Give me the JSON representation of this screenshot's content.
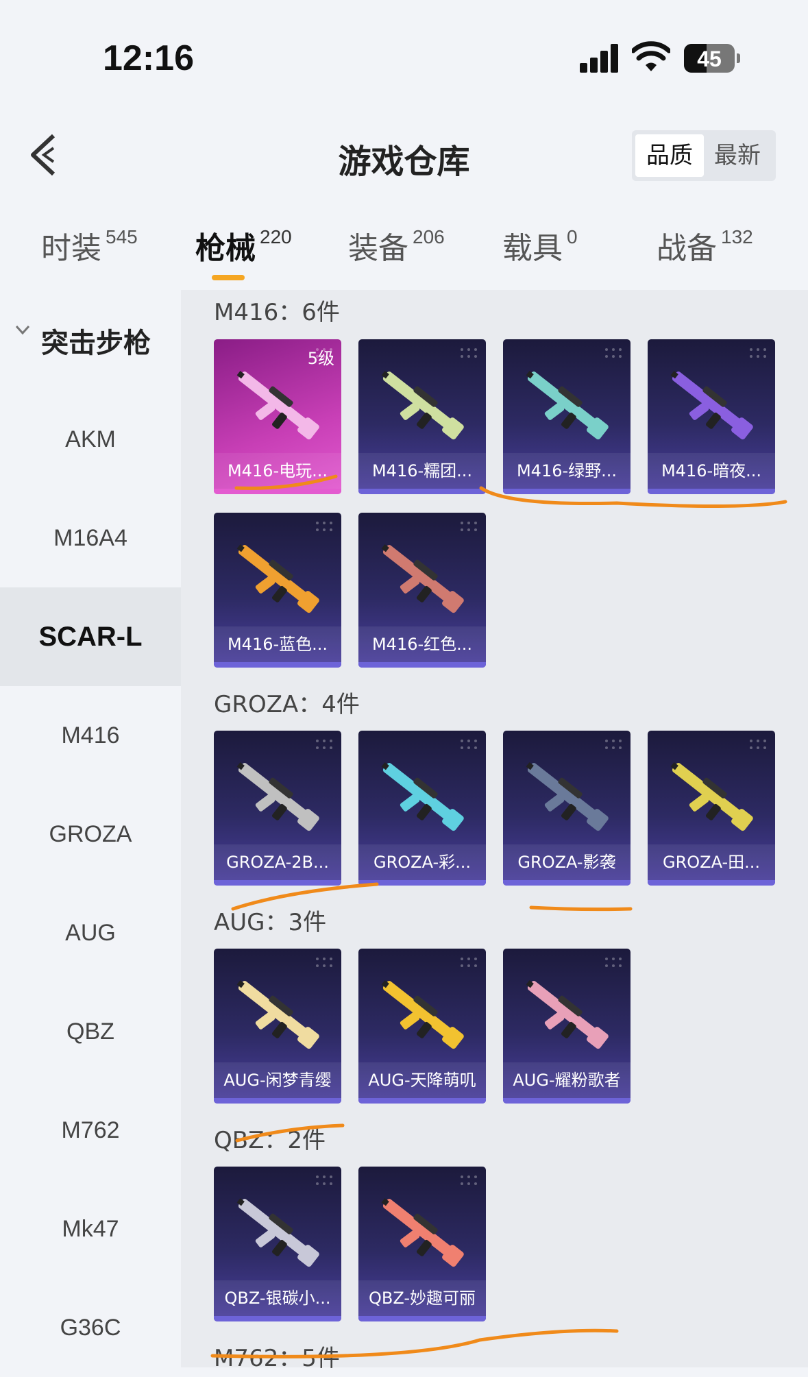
{
  "status_bar": {
    "time": "12:16",
    "battery": "45"
  },
  "header": {
    "title": "游戏仓库",
    "sort_options": [
      "品质",
      "最新"
    ]
  },
  "tabs": [
    {
      "label": "时装",
      "count": "545"
    },
    {
      "label": "枪械",
      "count": "220"
    },
    {
      "label": "装备",
      "count": "206"
    },
    {
      "label": "载具",
      "count": "0"
    },
    {
      "label": "战备",
      "count": "132"
    }
  ],
  "sidebar": {
    "category": "突击步枪",
    "items": [
      "AKM",
      "M16A4",
      "SCAR-L",
      "M416",
      "GROZA",
      "AUG",
      "QBZ",
      "M762",
      "Mk47",
      "G36C"
    ],
    "selected": "SCAR-L"
  },
  "groups": [
    {
      "title": "M416：6件",
      "items": [
        {
          "name": "M416-电玩...",
          "level": "5级",
          "color": "pink"
        },
        {
          "name": "M416-糯团...",
          "color": "#cfe0a0"
        },
        {
          "name": "M416-绿野...",
          "color": "#7ad0c9"
        },
        {
          "name": "M416-暗夜...",
          "color": "#8a5fe0"
        },
        {
          "name": "M416-蓝色...",
          "color": "#f0a030"
        },
        {
          "name": "M416-红色...",
          "color": "#d07a70"
        }
      ]
    },
    {
      "title": "GROZA：4件",
      "items": [
        {
          "name": "GROZA-2B...",
          "color": "#c0c0c0"
        },
        {
          "name": "GROZA-彩...",
          "color": "#5fd0e0"
        },
        {
          "name": "GROZA-影袭",
          "color": "#6a7a9a"
        },
        {
          "name": "GROZA-田...",
          "color": "#e0d050"
        }
      ]
    },
    {
      "title": "AUG：3件",
      "items": [
        {
          "name": "AUG-闲梦青缨",
          "color": "#f0dca0"
        },
        {
          "name": "AUG-天降萌叽",
          "color": "#f2c230"
        },
        {
          "name": "AUG-耀粉歌者",
          "color": "#e8a0b8"
        }
      ]
    },
    {
      "title": "QBZ：2件",
      "items": [
        {
          "name": "QBZ-银碳小...",
          "color": "#c8c8d8"
        },
        {
          "name": "QBZ-妙趣可丽",
          "color": "#f08070"
        }
      ]
    },
    {
      "title": "M762：5件",
      "items": []
    }
  ],
  "colors": {
    "accent": "#f5a623",
    "marker": "#f08a1a"
  }
}
